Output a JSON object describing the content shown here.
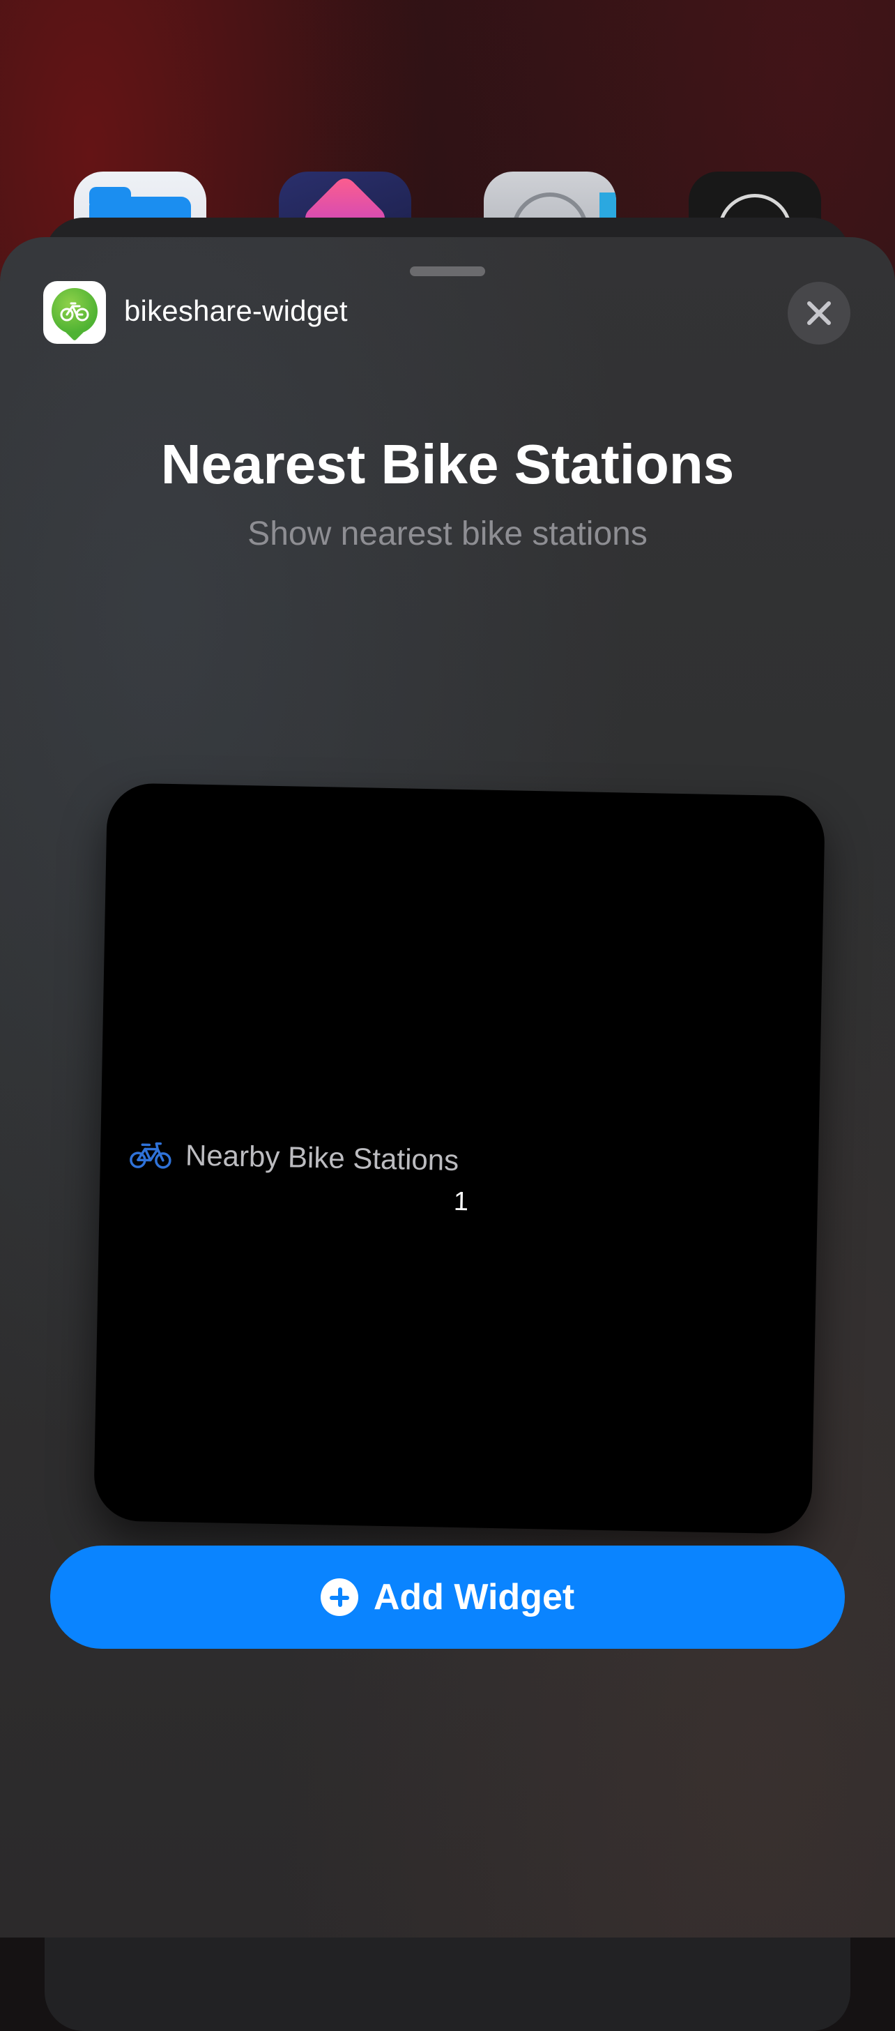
{
  "home_screen": {
    "icons": [
      "folder-icon",
      "shortcuts-icon",
      "settings-icon",
      "watch-icon"
    ]
  },
  "sheet": {
    "app_name": "bikeshare-widget",
    "app_icon": "bike-pin-icon",
    "close_icon": "close-icon",
    "title": "Nearest Bike Stations",
    "subtitle": "Show nearest bike stations"
  },
  "widget_preview": {
    "label": "Nearby Bike Stations",
    "count": "1",
    "icon": "bicycle-icon"
  },
  "add_button": {
    "label": "Add Widget",
    "icon": "plus-circle-icon"
  },
  "colors": {
    "accent": "#0a84ff",
    "sheet_bg": "#303032",
    "widget_bg": "#000000",
    "app_icon_green": "#4fb333"
  }
}
